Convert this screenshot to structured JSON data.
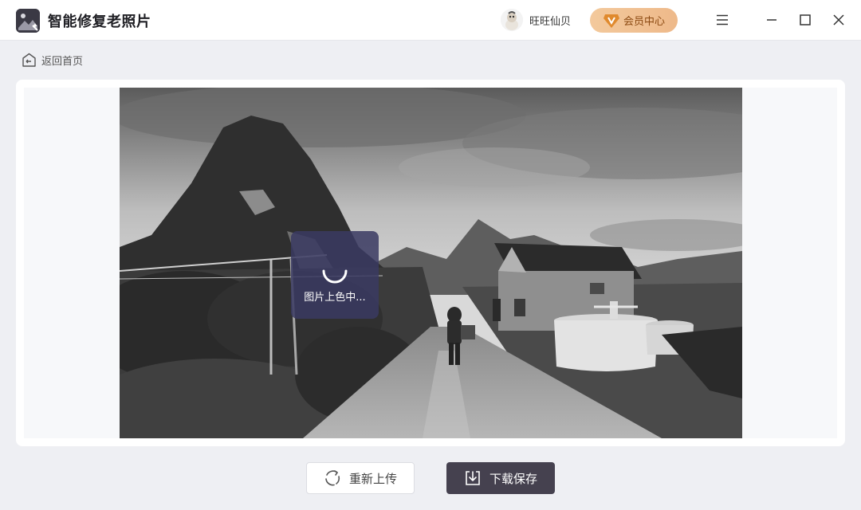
{
  "app": {
    "title": "智能修复老照片",
    "logo_icon": "photo-magic-icon"
  },
  "user": {
    "name": "旺旺仙贝",
    "avatar_icon": "avatar-icon"
  },
  "vip": {
    "label": "会员中心",
    "icon": "vip-diamond-icon",
    "colors": {
      "background": "#f0c094",
      "text": "#8c4a12",
      "badge": "#e08a2e"
    }
  },
  "window_controls": {
    "menu_icon": "menu-icon",
    "minimize_icon": "minimize-icon",
    "maximize_icon": "maximize-icon",
    "close_icon": "close-icon"
  },
  "nav": {
    "back_label": "返回首页",
    "back_icon": "home-back-icon"
  },
  "preview": {
    "photo_subject": "black-and-white rural landscape with karst mountain, house and path",
    "status_text": "图片上色中...",
    "spinner_icon": "loading-spinner-icon"
  },
  "actions": {
    "reupload_label": "重新上传",
    "reupload_icon": "refresh-icon",
    "download_label": "下载保存",
    "download_icon": "download-icon"
  },
  "colors": {
    "page_background": "#eeeff3",
    "primary_button": "#45414f",
    "loading_overlay": "#3a3a62"
  }
}
